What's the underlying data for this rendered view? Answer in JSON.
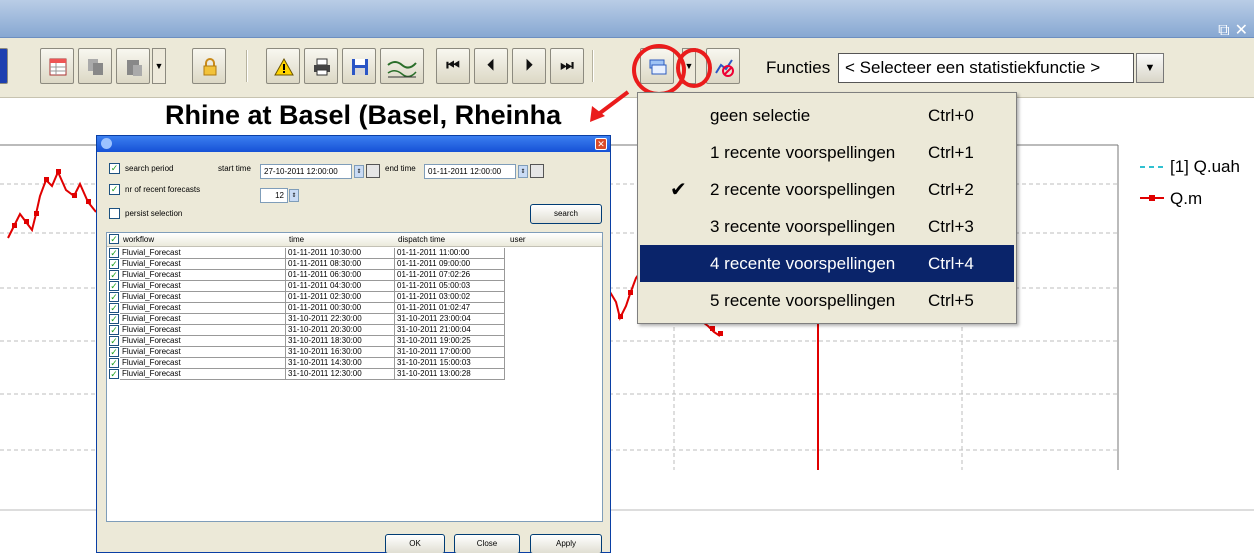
{
  "toolbar": {
    "functies_label": "Functies",
    "functies_value": "< Selecteer een statistiekfunctie >"
  },
  "chart": {
    "title": "Rhine at Basel (Basel, Rheinha",
    "legend": [
      {
        "label": "[1] Q.uah",
        "color": "#30c0d0",
        "style": "dashed"
      },
      {
        "label": "Q.m",
        "color": "#e00000",
        "style": "solid-square"
      }
    ],
    "series_color": "#e00000"
  },
  "menu": {
    "items": [
      {
        "label": "geen selectie",
        "shortcut": "Ctrl+0",
        "checked": false,
        "selected": false
      },
      {
        "label": "1 recente voorspellingen",
        "shortcut": "Ctrl+1",
        "checked": false,
        "selected": false
      },
      {
        "label": "2 recente voorspellingen",
        "shortcut": "Ctrl+2",
        "checked": true,
        "selected": false
      },
      {
        "label": "3 recente voorspellingen",
        "shortcut": "Ctrl+3",
        "checked": false,
        "selected": false
      },
      {
        "label": "4 recente voorspellingen",
        "shortcut": "Ctrl+4",
        "checked": false,
        "selected": true
      },
      {
        "label": "5 recente voorspellingen",
        "shortcut": "Ctrl+5",
        "checked": false,
        "selected": false
      }
    ]
  },
  "dialog": {
    "search_period_label": "search period",
    "search_period_checked": true,
    "start_time_label": "start time",
    "start_time_value": "27-10-2011 12:00:00",
    "end_time_label": "end time",
    "end_time_value": "01-11-2011 12:00:00",
    "recent_label": "nr of recent forecasts",
    "recent_checked": true,
    "recent_value": "12",
    "persist_label": "persist selection",
    "persist_checked": false,
    "search_button": "search",
    "columns": [
      "workflow",
      "time",
      "dispatch time",
      "user"
    ],
    "rows": [
      {
        "workflow": "Fluvial_Forecast",
        "time": "01-11-2011 10:30:00",
        "dispatch": "01-11-2011 11:00:00"
      },
      {
        "workflow": "Fluvial_Forecast",
        "time": "01-11-2011 08:30:00",
        "dispatch": "01-11-2011 09:00:00"
      },
      {
        "workflow": "Fluvial_Forecast",
        "time": "01-11-2011 06:30:00",
        "dispatch": "01-11-2011 07:02:26"
      },
      {
        "workflow": "Fluvial_Forecast",
        "time": "01-11-2011 04:30:00",
        "dispatch": "01-11-2011 05:00:03"
      },
      {
        "workflow": "Fluvial_Forecast",
        "time": "01-11-2011 02:30:00",
        "dispatch": "01-11-2011 03:00:02"
      },
      {
        "workflow": "Fluvial_Forecast",
        "time": "01-11-2011 00:30:00",
        "dispatch": "01-11-2011 01:02:47"
      },
      {
        "workflow": "Fluvial_Forecast",
        "time": "31-10-2011 22:30:00",
        "dispatch": "31-10-2011 23:00:04"
      },
      {
        "workflow": "Fluvial_Forecast",
        "time": "31-10-2011 20:30:00",
        "dispatch": "31-10-2011 21:00:04"
      },
      {
        "workflow": "Fluvial_Forecast",
        "time": "31-10-2011 18:30:00",
        "dispatch": "31-10-2011 19:00:25"
      },
      {
        "workflow": "Fluvial_Forecast",
        "time": "31-10-2011 16:30:00",
        "dispatch": "31-10-2011 17:00:00"
      },
      {
        "workflow": "Fluvial_Forecast",
        "time": "31-10-2011 14:30:00",
        "dispatch": "31-10-2011 15:00:03"
      },
      {
        "workflow": "Fluvial_Forecast",
        "time": "31-10-2011 12:30:00",
        "dispatch": "31-10-2011 13:00:28"
      }
    ],
    "ok_button": "OK",
    "close_button": "Close",
    "apply_button": "Apply"
  },
  "colors": {
    "accent": "#ea1c1c",
    "menu_highlight": "#0a246a"
  }
}
